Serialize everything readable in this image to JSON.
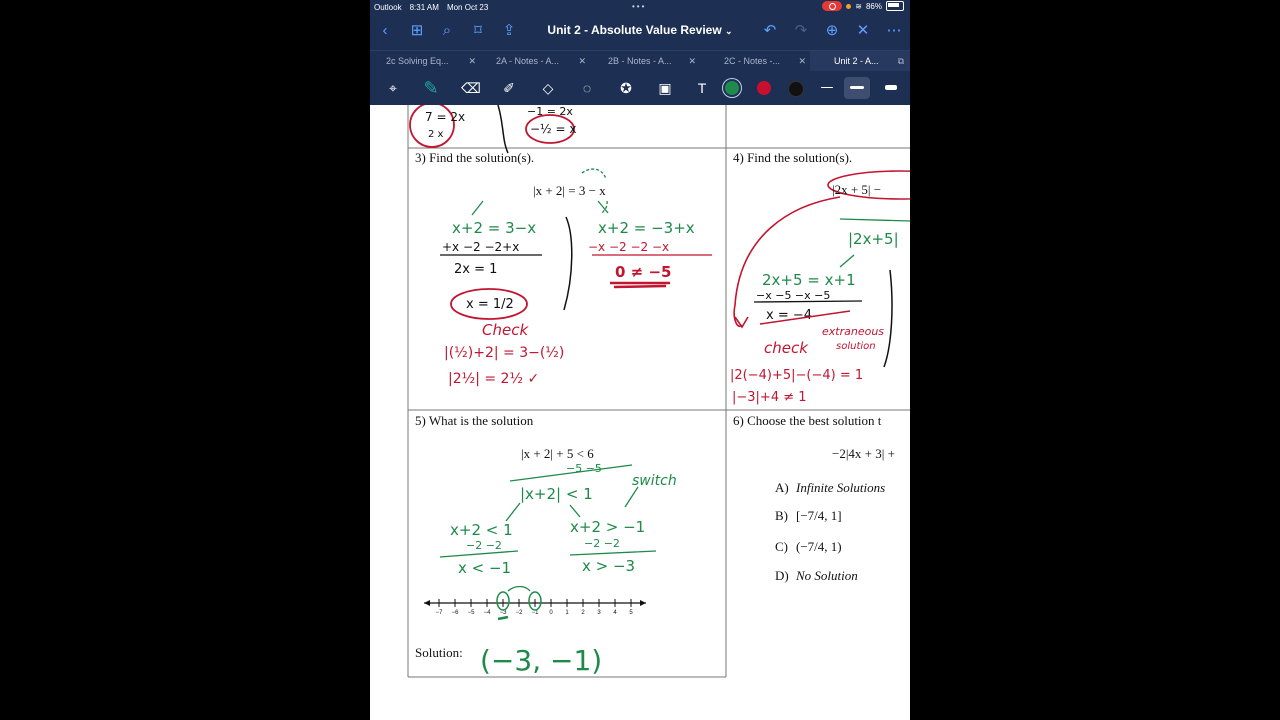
{
  "status": {
    "app": "Outlook",
    "time": "8:31 AM",
    "date": "Mon Oct 23",
    "battery": "86%"
  },
  "nav": {
    "title": "Unit 2 - Absolute Value Review"
  },
  "tabs": [
    {
      "label": "2c Solving Eq..."
    },
    {
      "label": "2A - Notes - A..."
    },
    {
      "label": "2B - Notes - A..."
    },
    {
      "label": "2C - Notes -..."
    },
    {
      "label": "Unit 2 - A..."
    }
  ],
  "colors": {
    "green": "#1f8a4c",
    "red": "#c8102e",
    "black": "#111111",
    "ink_green": "#1e8a4a",
    "ink_red": "#c21530"
  },
  "worksheet": {
    "q3": {
      "prompt": "3)  Find the solution(s).",
      "equation": "|x + 2| = 3 − x"
    },
    "q4": {
      "prompt": "4)  Find the solution(s).",
      "equation": "|2x + 5| −"
    },
    "q5": {
      "prompt": "5)  What is the solution",
      "inequality": "|x + 2| + 5 < 6",
      "solution_label": "Solution:"
    },
    "q6": {
      "prompt": "6)  Choose the best solution t",
      "equation": "−2|4x + 3| +",
      "choices": [
        {
          "letter": "A)",
          "text": "Infinite Solutions"
        },
        {
          "letter": "B)",
          "text": "[−7/4, 1]"
        },
        {
          "letter": "C)",
          "text": "(−7/4, 1)"
        },
        {
          "letter": "D)",
          "text": "No Solution"
        }
      ]
    },
    "number_line": {
      "ticks": [
        "−7",
        "−6",
        "−5",
        "−4",
        "−3",
        "−2",
        "−1",
        "0",
        "1",
        "2",
        "3",
        "4",
        "5"
      ]
    }
  },
  "handwriting": {
    "q3_left": [
      "x+2 = 3−x",
      "+x −2  −2+x",
      "2x = 1",
      "x = 1/2",
      "Check",
      "|(½)+2| = 3−(½)",
      "|2½| = 2½ ✓"
    ],
    "q3_right": [
      "x+2 = −3+x",
      "−x −2   −2 −x",
      "0 ≠ −5"
    ],
    "q4": [
      "|2x+5|",
      "2x+5 = x+1",
      "−x  −5  −x −5",
      "x = −4",
      "extraneous",
      "solution",
      "check",
      "|2(−4)+5|−(−4) = 1",
      "|−3|+4 ≠ 1"
    ],
    "q5": [
      "−5  −5",
      "|x+2| < 1",
      "switch",
      "x+2 < 1",
      "−2  −2",
      "x < −1",
      "x+2 > −1",
      "−2   −2",
      "x > −3",
      "(−3, −1)"
    ],
    "top": [
      "7 = 2x",
      "2    x",
      "−1 = 2x",
      "−½ = x"
    ]
  }
}
